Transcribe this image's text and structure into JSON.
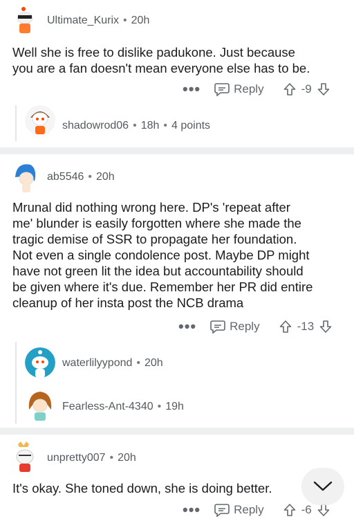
{
  "comments": [
    {
      "username": "Ultimate_Kurix",
      "time": "20h",
      "body_lines": [
        "Well she is free to dislike padukone. Just because",
        "you are a fan doesn't mean everyone else has to be."
      ],
      "reply_label": "Reply",
      "score": "-9",
      "more": "•••"
    },
    {
      "username": "ab5546",
      "time": "20h",
      "body_lines": [
        "Mrunal did nothing wrong here. DP's 'repeat after",
        "me' blunder is easily forgotten where she made the",
        "tragic demise of SSR to propagate her foundation.",
        "Not even a single condolence post. Maybe DP might",
        "have not green lit the idea but accountability should",
        "be given where it's due. Remember her PR did entire",
        "cleanup of her insta post the NCB drama"
      ],
      "reply_label": "Reply",
      "score": "-13",
      "more": "•••"
    },
    {
      "username": "unpretty007",
      "time": "20h",
      "body_lines": [
        "It's okay. She toned down, she is doing better."
      ],
      "reply_label": "Reply",
      "score": "-6",
      "more": "•••"
    }
  ],
  "collapsed_replies": [
    {
      "username": "shadowrod06",
      "time": "18h",
      "points": "4 points"
    },
    {
      "username": "waterlilyypond",
      "time": "20h"
    },
    {
      "username": "Fearless-Ant-4340",
      "time": "19h"
    }
  ],
  "colors": {
    "divider": "#edeff1",
    "text": "#1c1c1c",
    "meta": "#555a5e",
    "reddit_orange": "#ff4500"
  }
}
